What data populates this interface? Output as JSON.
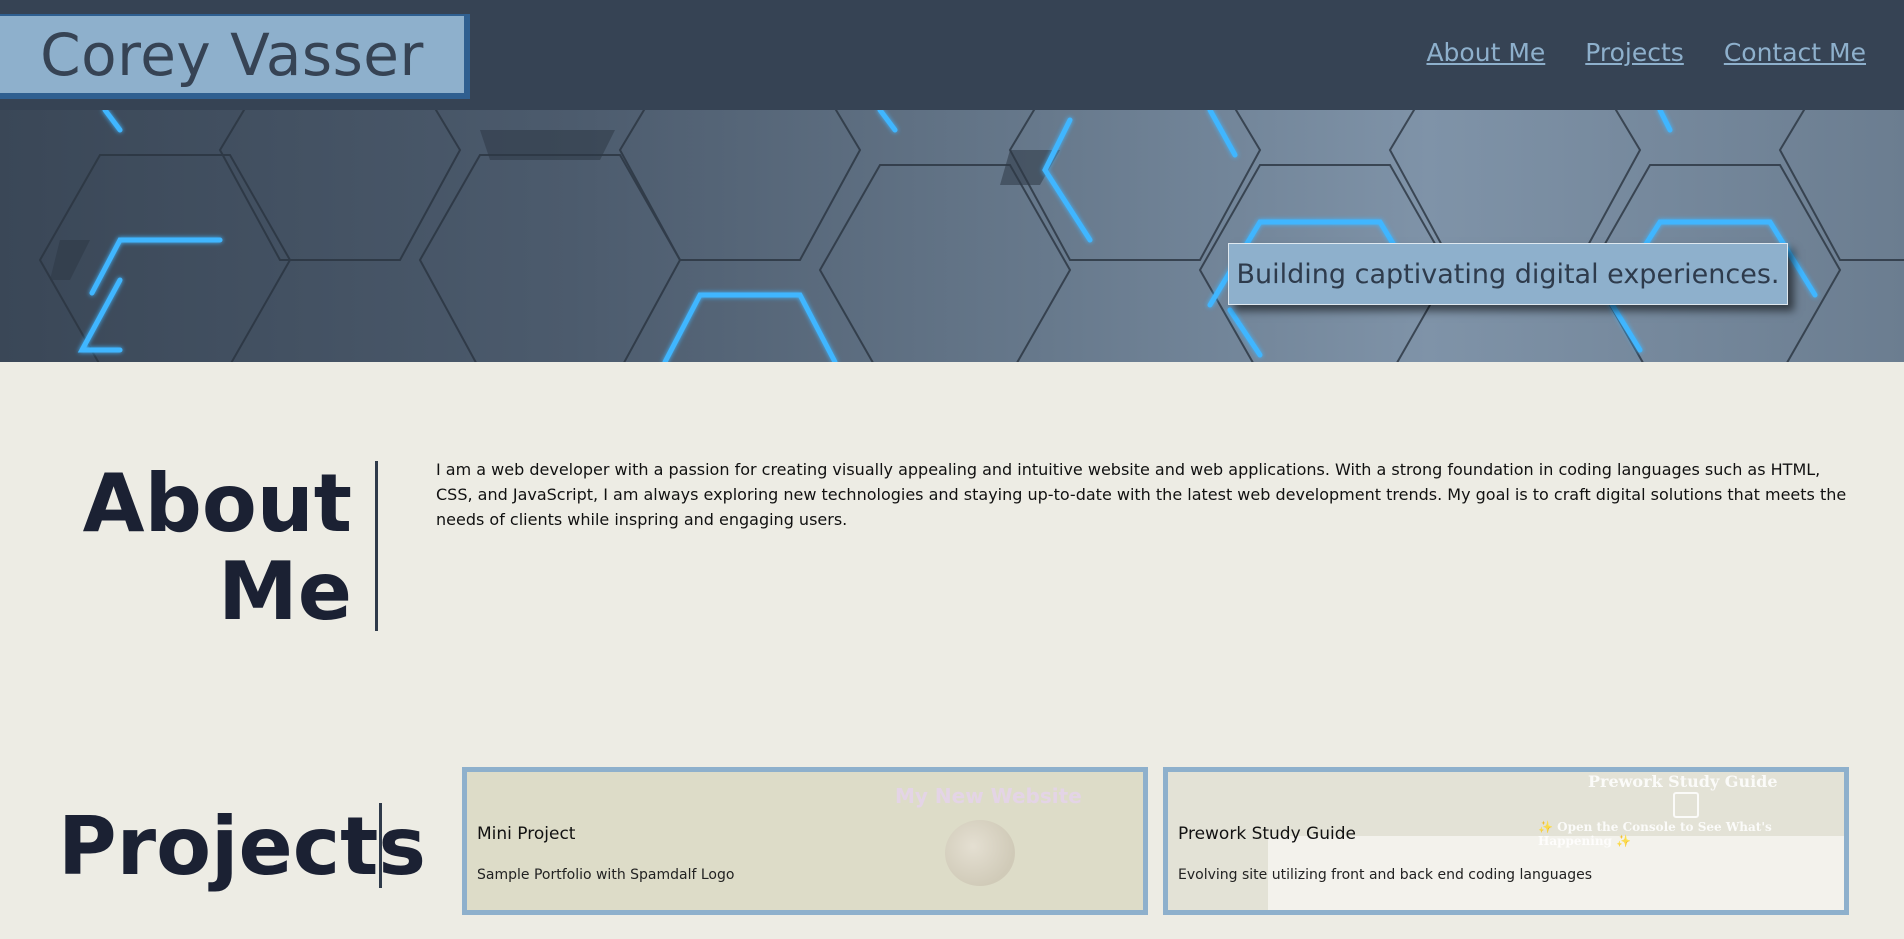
{
  "header": {
    "name": "Corey Vasser",
    "nav": [
      "About Me",
      "Projects",
      "Contact Me"
    ]
  },
  "hero": {
    "tagline": "Building captivating digital experiences."
  },
  "about": {
    "title_line1": "About",
    "title_line2": "Me",
    "text": "I am a web developer with a passion for creating visually appealing and intuitive website and web applications. With a strong foundation in coding languages such as HTML, CSS, and JavaScript, I am always exploring new technologies and staying up-to-date with the latest web development trends. My goal is to craft digital solutions that meets the needs of clients while inspring and engaging users."
  },
  "projects": {
    "title": "Projects",
    "cards": [
      {
        "title": "Mini Project",
        "description": "Sample Portfolio with Spamdalf Logo",
        "preview_heading": "My New Website"
      },
      {
        "title": "Prework Study Guide",
        "description": "Evolving site utilizing front and back end coding languages",
        "preview_heading": "Prework Study Guide",
        "preview_subheading": "✨ Open the Console to See What's Happening ✨"
      }
    ]
  },
  "colors": {
    "header_bg": "#364354",
    "accent": "#8eb0cc",
    "page_bg": "#edece4",
    "neon": "#3fb6ff"
  }
}
